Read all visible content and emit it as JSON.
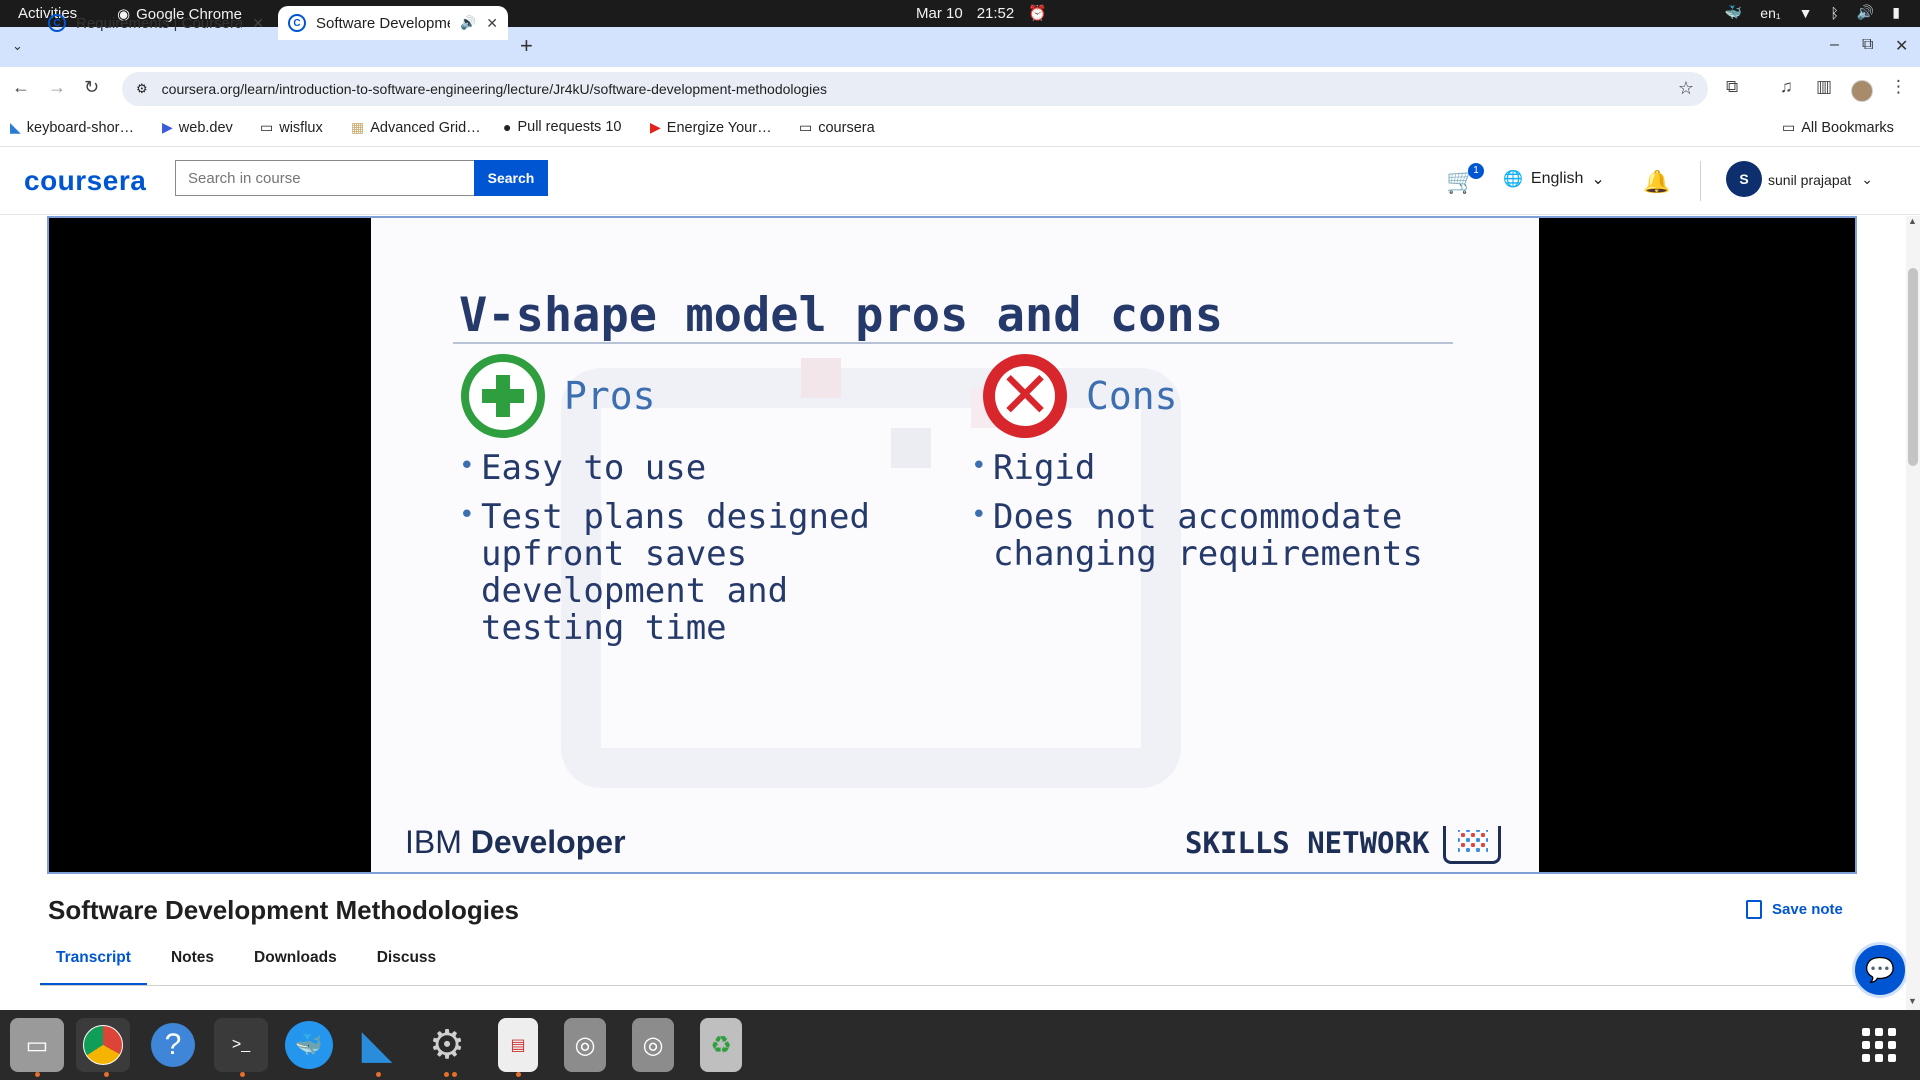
{
  "system": {
    "activities": "Activities",
    "app_name": "Google Chrome",
    "date": "Mar 10",
    "time": "21:52",
    "input_lang": "en₁"
  },
  "browser": {
    "tabs": [
      {
        "title": "Requirements | Coursera",
        "active": false
      },
      {
        "title": "Software Developme",
        "active": true
      }
    ],
    "url": "coursera.org/learn/introduction-to-software-engineering/lecture/Jr4kU/software-development-methodologies",
    "bookmarks": [
      {
        "label": "keyboard-shor…",
        "icon": "vscode-icon"
      },
      {
        "label": "web.dev",
        "icon": "webdev-icon"
      },
      {
        "label": "wisflux",
        "icon": "folder-icon"
      },
      {
        "label": "Advanced Grid…",
        "icon": "grid-icon"
      },
      {
        "label": "Pull requests 10",
        "icon": "github-icon"
      },
      {
        "label": "Energize Your…",
        "icon": "youtube-icon"
      },
      {
        "label": "coursera",
        "icon": "folder-icon"
      }
    ],
    "all_bookmarks": "All Bookmarks"
  },
  "coursera": {
    "logo": "coursera",
    "search_placeholder": "Search in course",
    "search_button": "Search",
    "cart_count": "1",
    "language": "English",
    "user_initial": "S",
    "user_name": "sunil prajapat"
  },
  "slide": {
    "title": "V-shape model pros and cons",
    "pros_heading": "Pros",
    "cons_heading": "Cons",
    "pros": [
      "Easy to use",
      "Test plans designed upfront saves development and testing time"
    ],
    "cons": [
      "Rigid",
      "Does not accommodate changing requirements"
    ],
    "brand_left_a": "IBM",
    "brand_left_b": "Developer",
    "brand_right": "SKILLS NETWORK"
  },
  "lecture": {
    "title": "Software Development Methodologies",
    "save_note": "Save note",
    "tabs": [
      "Transcript",
      "Notes",
      "Downloads",
      "Discuss"
    ],
    "active_tab": "Transcript"
  },
  "colors": {
    "coursera_blue": "#0056d2",
    "slide_navy": "#253a6b",
    "pros_green": "#2e9e3f",
    "cons_red": "#d8262d"
  }
}
